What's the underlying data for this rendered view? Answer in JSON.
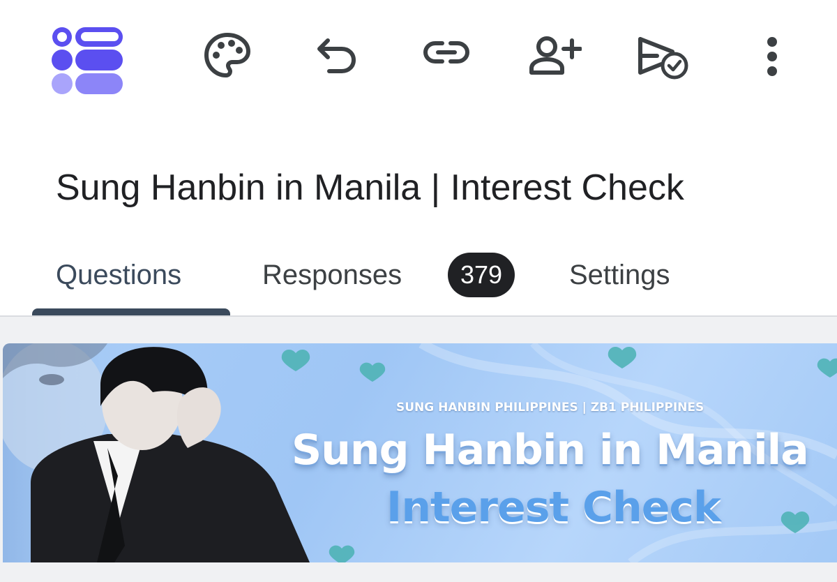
{
  "toolbar": {
    "app_logo": "forms-logo-icon",
    "icons": [
      "palette-icon",
      "undo-icon",
      "link-icon",
      "add-collaborator-icon",
      "publish-icon",
      "more-options-icon"
    ],
    "accent_color": "#5b4ff0"
  },
  "form": {
    "title": "Sung Hanbin in Manila | Interest Check"
  },
  "tabs": {
    "questions": "Questions",
    "responses": "Responses",
    "responses_count": "379",
    "settings": "Settings",
    "active": "Questions"
  },
  "banner": {
    "small_text": "SUNG HANBIN  PHILIPPINES | ZB1 PHILIPPINES",
    "title": "Sung Hanbin in Manila",
    "subtitle": "Interest Check",
    "background_color": "#a9cdf7",
    "heart_color": "#4fb3b6"
  }
}
